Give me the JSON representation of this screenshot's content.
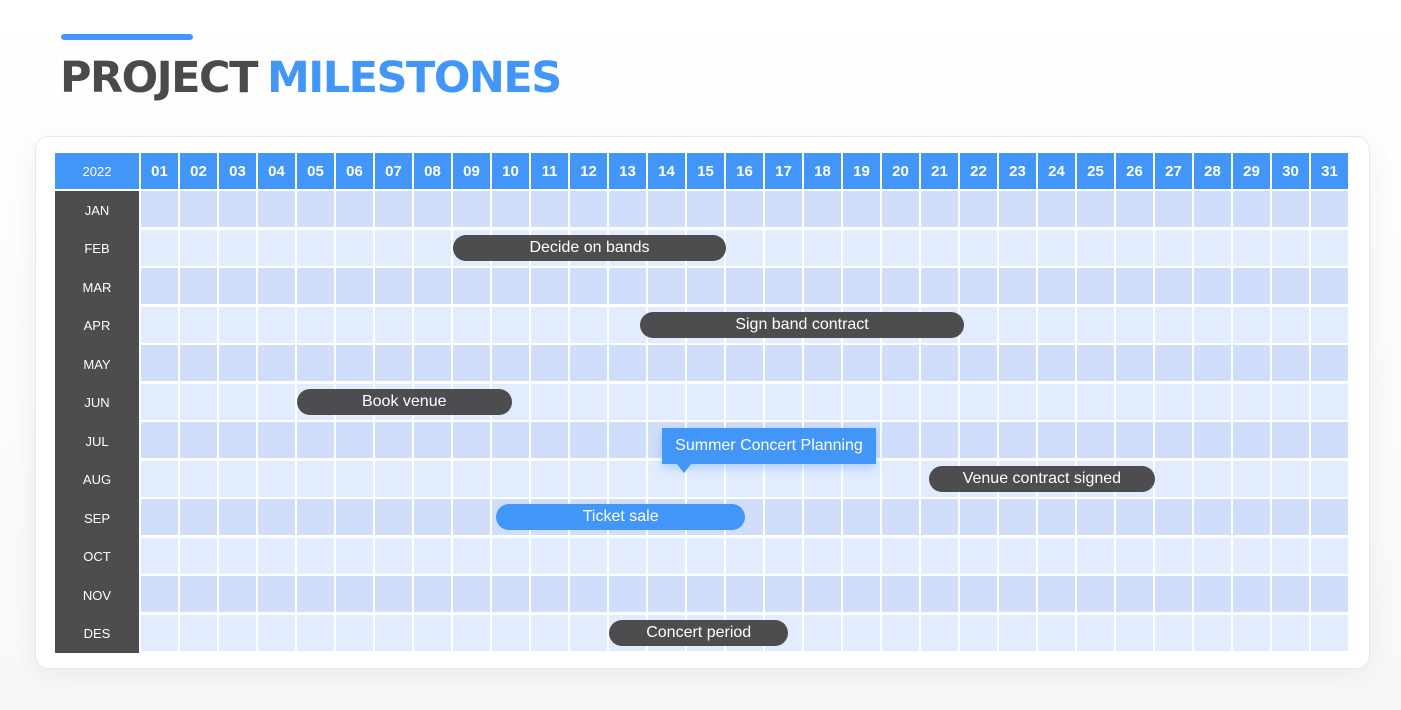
{
  "title": {
    "part1": "PROJECT",
    "part2": "MILESTONES"
  },
  "colors": {
    "accent": "#4296f8",
    "dark": "#4d4d4f",
    "row_a": "#d0defc",
    "row_b": "#e3ecfd"
  },
  "calendar": {
    "year": "2022",
    "days": [
      "01",
      "02",
      "03",
      "04",
      "05",
      "06",
      "07",
      "08",
      "09",
      "10",
      "11",
      "12",
      "13",
      "14",
      "15",
      "16",
      "17",
      "18",
      "19",
      "20",
      "21",
      "22",
      "23",
      "24",
      "25",
      "26",
      "27",
      "28",
      "29",
      "30",
      "31"
    ],
    "months": [
      "JAN",
      "FEB",
      "MAR",
      "APR",
      "MAY",
      "JUN",
      "JUL",
      "AUG",
      "SEP",
      "OCT",
      "NOV",
      "DES"
    ]
  },
  "milestones": [
    {
      "label": "Decide on bands",
      "month": "FEB",
      "start_day": 9.0,
      "end_day": 16.0,
      "style": "dark"
    },
    {
      "label": "Sign band contract",
      "month": "APR",
      "start_day": 13.8,
      "end_day": 22.1,
      "style": "dark"
    },
    {
      "label": "Book venue",
      "month": "JUN",
      "start_day": 5.0,
      "end_day": 10.5,
      "style": "dark"
    },
    {
      "label": "Venue contract signed",
      "month": "AUG",
      "start_day": 21.2,
      "end_day": 27.0,
      "style": "dark"
    },
    {
      "label": "Ticket sale",
      "month": "SEP",
      "start_day": 10.1,
      "end_day": 16.5,
      "style": "accent"
    },
    {
      "label": "Concert period",
      "month": "DES",
      "start_day": 13.0,
      "end_day": 17.6,
      "style": "dark"
    }
  ],
  "callout": {
    "label": "Summer Concert Planning",
    "month": "JUL"
  }
}
